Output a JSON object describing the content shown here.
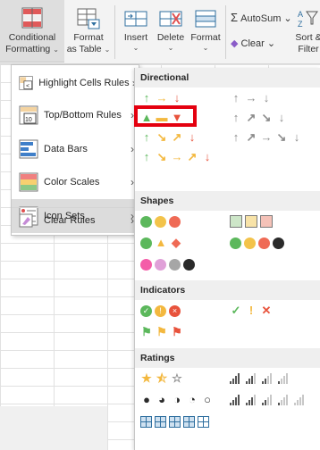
{
  "ribbon": {
    "conditional_formatting": "Conditional",
    "conditional_formatting_2": "Formatting",
    "format_as_table": "Format",
    "format_as_table_2": "as Table",
    "insert": "Insert",
    "delete": "Delete",
    "format": "Format",
    "autosum": "AutoSum",
    "clear": "Clear",
    "sort_filter": "Sort &",
    "sort_filter_2": "Filter"
  },
  "menu": {
    "items": [
      {
        "label": "Highlight Cells Rules",
        "icon": "highlight-cells-icon"
      },
      {
        "label": "Top/Bottom Rules",
        "icon": "top-bottom-icon"
      },
      {
        "label": "Data Bars",
        "icon": "data-bars-icon"
      },
      {
        "label": "Color Scales",
        "icon": "color-scales-icon"
      },
      {
        "label": "Icon Sets",
        "icon": "icon-sets-icon"
      },
      {
        "label": "Clear Rules",
        "icon": "clear-rules-icon"
      }
    ]
  },
  "submenu": {
    "directional": "Directional",
    "shapes": "Shapes",
    "indicators": "Indicators",
    "ratings": "Ratings"
  },
  "colors": {
    "green": "#5cb85c",
    "yellow": "#f3b83f",
    "red": "#e8533c",
    "gray": "#8c8c8c",
    "pink": "#f45ca8",
    "black": "#2a2a2a",
    "highlight": "#e4000f"
  }
}
